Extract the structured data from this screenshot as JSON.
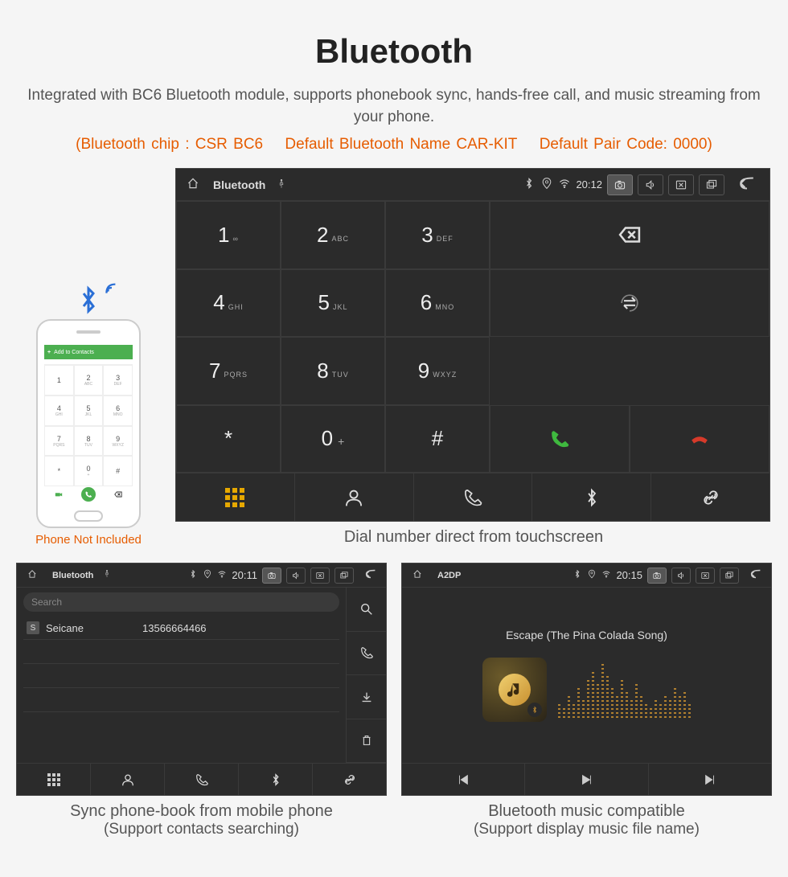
{
  "title": "Bluetooth",
  "subtitle": "Integrated with BC6 Bluetooth module, supports phonebook sync, hands-free call, and music streaming from your phone.",
  "chipinfo": {
    "chip": "(Bluetooth chip : CSR BC6",
    "name": "Default Bluetooth Name CAR-KIT",
    "code": "Default Pair Code: 0000)"
  },
  "phone_mock": {
    "header": "Add to Contacts",
    "note": "Phone Not Included"
  },
  "dialer": {
    "statusbar": {
      "app": "Bluetooth",
      "time": "20:12"
    },
    "keys": [
      {
        "d": "1",
        "s": "∞"
      },
      {
        "d": "2",
        "s": "ABC"
      },
      {
        "d": "3",
        "s": "DEF"
      },
      {
        "d": "4",
        "s": "GHI"
      },
      {
        "d": "5",
        "s": "JKL"
      },
      {
        "d": "6",
        "s": "MNO"
      },
      {
        "d": "7",
        "s": "PQRS"
      },
      {
        "d": "8",
        "s": "TUV"
      },
      {
        "d": "9",
        "s": "WXYZ"
      },
      {
        "d": "*",
        "s": ""
      },
      {
        "d": "0",
        "s": "+"
      },
      {
        "d": "#",
        "s": ""
      }
    ],
    "caption": "Dial number direct from touchscreen"
  },
  "phonebook": {
    "statusbar": {
      "app": "Bluetooth",
      "time": "20:11"
    },
    "search_placeholder": "Search",
    "entry": {
      "badge": "S",
      "name": "Seicane",
      "number": "13566664466"
    },
    "caption_l1": "Sync phone-book from mobile phone",
    "caption_l2": "(Support contacts searching)"
  },
  "music": {
    "statusbar": {
      "app": "A2DP",
      "time": "20:15"
    },
    "track": "Escape (The Pina Colada Song)",
    "caption_l1": "Bluetooth music compatible",
    "caption_l2": "(Support display music file name)"
  },
  "eq_heights": [
    20,
    15,
    30,
    18,
    40,
    25,
    50,
    60,
    45,
    70,
    55,
    40,
    30,
    50,
    35,
    25,
    45,
    30,
    20,
    15,
    25,
    18,
    30,
    22,
    40,
    28,
    35,
    20
  ]
}
